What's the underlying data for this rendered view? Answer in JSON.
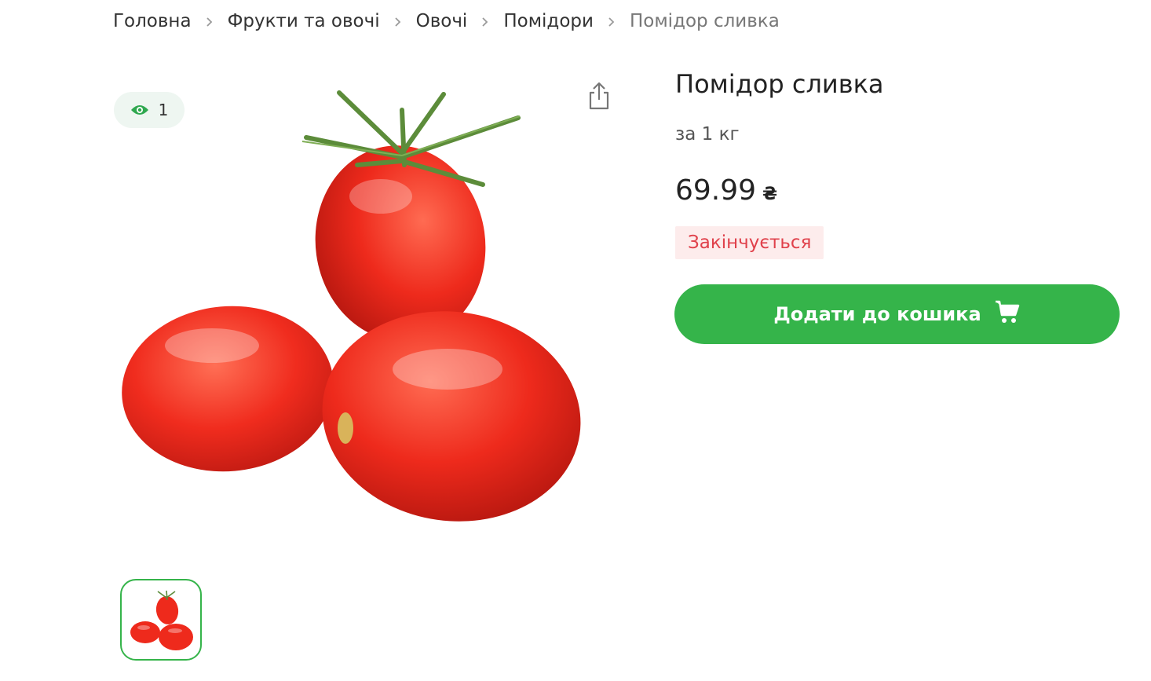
{
  "breadcrumb": {
    "items": [
      {
        "label": "Головна"
      },
      {
        "label": "Фрукти та овочі"
      },
      {
        "label": "Овочі"
      },
      {
        "label": "Помідори"
      },
      {
        "label": "Помідор сливка"
      }
    ]
  },
  "gallery": {
    "views_count": "1",
    "icons": {
      "views": "eye-icon",
      "share": "share-icon"
    }
  },
  "product": {
    "title": "Помідор сливка",
    "unit": "за 1 кг",
    "price": "69.99",
    "currency": "₴",
    "stock_status": "Закінчується",
    "add_to_cart_label": "Додати до кошика",
    "cart_icon": "cart-icon"
  },
  "colors": {
    "accent_green": "#35b44a",
    "stock_red": "#e0414b",
    "stock_bg": "#fdecec",
    "badge_bg": "#eef6f1",
    "tomato_red": "#e8251d"
  }
}
